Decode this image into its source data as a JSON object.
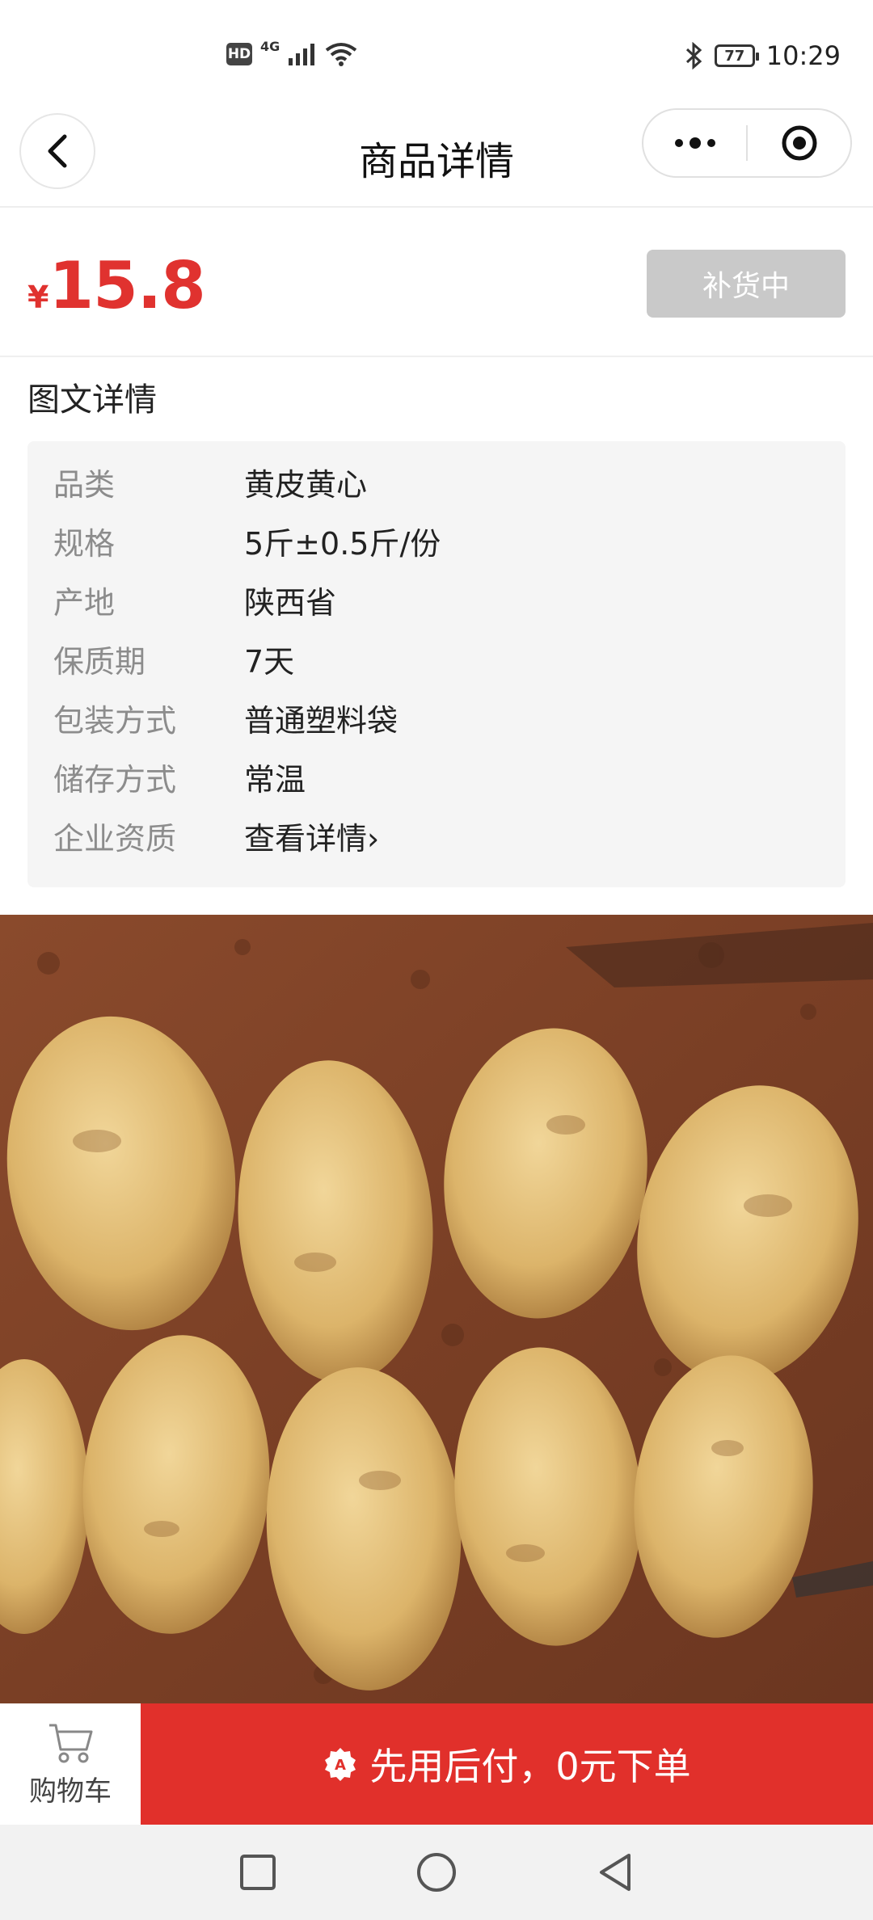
{
  "status_bar": {
    "hd": "HD",
    "network": "4G",
    "battery": "77",
    "time": "10:29"
  },
  "header": {
    "title": "商品详情",
    "icons": [
      "back-icon",
      "more-icon",
      "mini-program-close-icon"
    ]
  },
  "price": {
    "currency": "¥",
    "value": "15.8",
    "color": "#e0322f"
  },
  "restock_button": "补货中",
  "details": {
    "title": "图文详情",
    "specs": [
      {
        "label": "品类",
        "value": "黄皮黄心"
      },
      {
        "label": "规格",
        "value": "5斤±0.5斤/份"
      },
      {
        "label": "产地",
        "value": "陕西省"
      },
      {
        "label": "保质期",
        "value": "7天"
      },
      {
        "label": "包装方式",
        "value": "普通塑料袋"
      },
      {
        "label": "储存方式",
        "value": "常温"
      },
      {
        "label": "企业资质",
        "value": "查看详情›"
      }
    ]
  },
  "bottom_bar": {
    "cart_label": "购物车",
    "order_label": "先用后付，0元下单",
    "order_color": "#e1302b"
  },
  "system_nav": [
    "recent-apps-icon",
    "home-icon",
    "back-triangle-icon"
  ]
}
